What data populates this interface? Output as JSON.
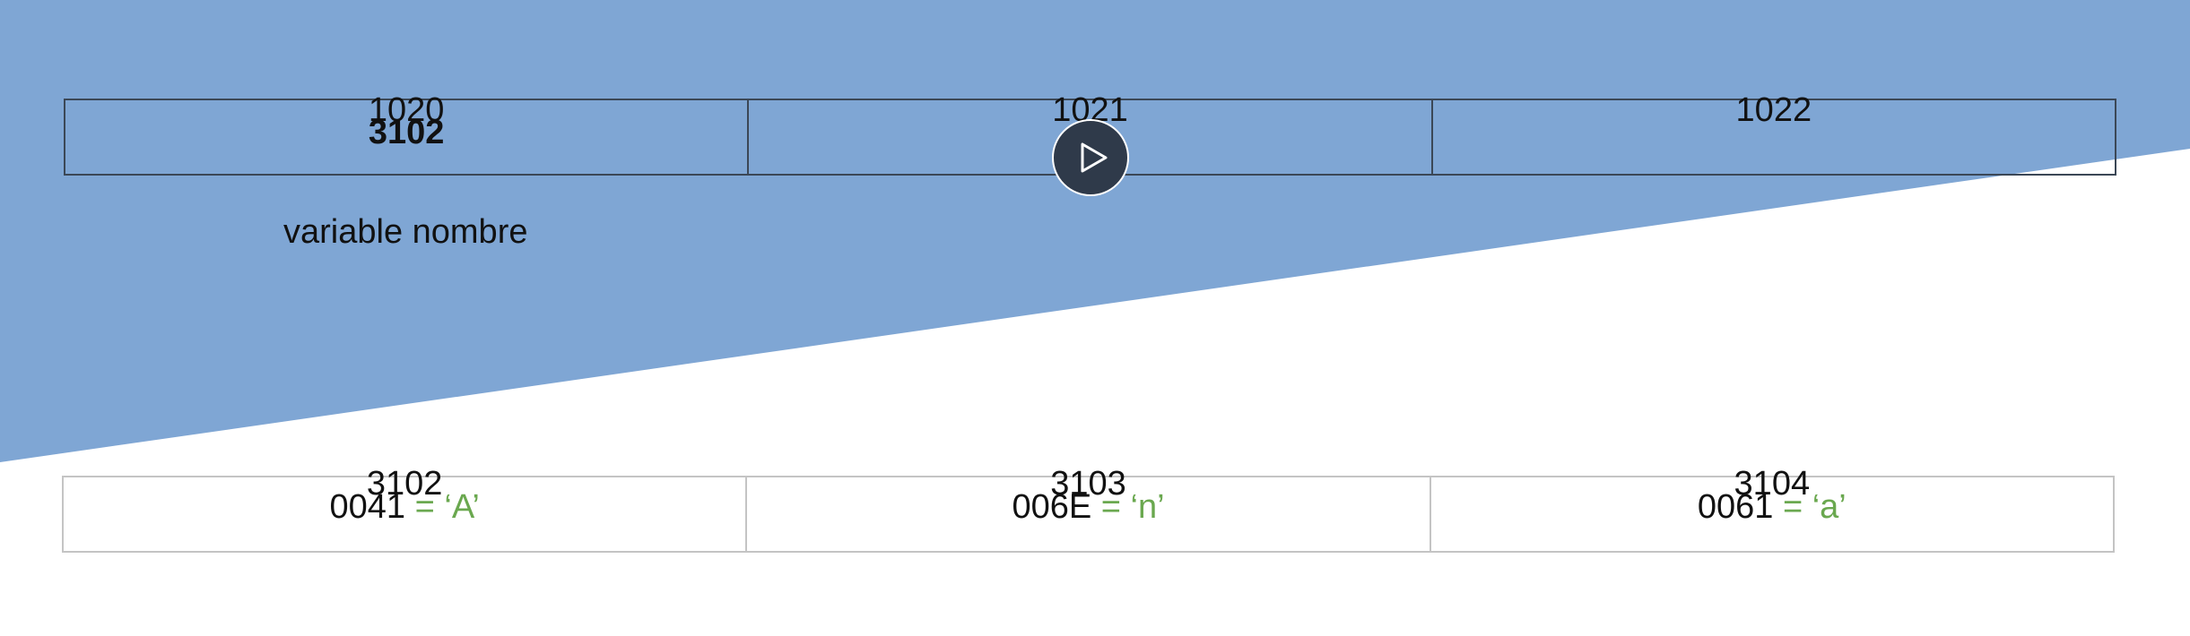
{
  "colors": {
    "background_wedge": "#7fa6d4",
    "top_border": "#3b4756",
    "bottom_border": "#c4c4c4",
    "char_highlight": "#6aa84f",
    "play_button": "#2f3a4a"
  },
  "top_memory": {
    "cells": [
      {
        "address": "1020",
        "value": "3102"
      },
      {
        "address": "1021",
        "value": ""
      },
      {
        "address": "1022",
        "value": ""
      }
    ],
    "label": "variable nombre"
  },
  "bottom_memory": {
    "cells": [
      {
        "address": "3102",
        "code": "0041",
        "char": "= ‘A’"
      },
      {
        "address": "3103",
        "code": "006E",
        "char": "= ‘n’"
      },
      {
        "address": "3104",
        "code": "0061",
        "char": "= ‘a’"
      }
    ]
  },
  "controls": {
    "play_icon": "play-icon"
  }
}
